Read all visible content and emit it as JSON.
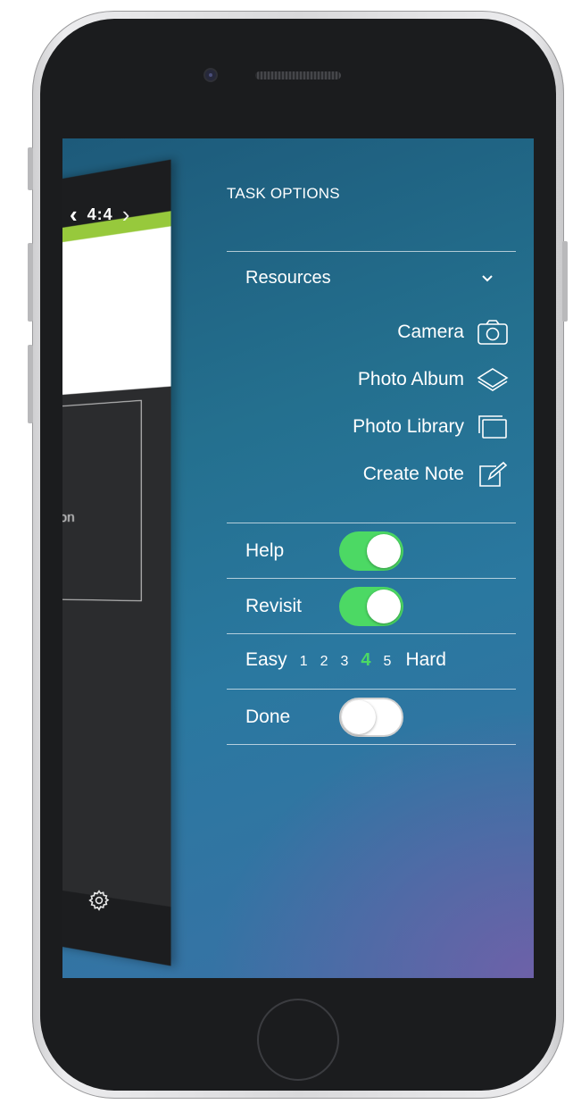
{
  "app_background": {
    "page_indicator": "4:4",
    "prev_icon": "chevron-left-icon",
    "next_icon": "chevron-right-icon",
    "truncated_text": "cher on",
    "settings_icon": "gear-icon",
    "accent_green": "#97c93c"
  },
  "task_options": {
    "title": "TASK OPTIONS",
    "resources": {
      "label": "Resources",
      "toggle_icon": "chevron-down-icon",
      "items": [
        {
          "label": "Camera",
          "icon": "camera-icon"
        },
        {
          "label": "Photo Album",
          "icon": "layers-icon"
        },
        {
          "label": "Photo Library",
          "icon": "library-icon"
        },
        {
          "label": "Create Note",
          "icon": "note-edit-icon"
        }
      ]
    },
    "help": {
      "label": "Help",
      "on": true
    },
    "revisit": {
      "label": "Revisit",
      "on": true
    },
    "difficulty": {
      "easy_label": "Easy",
      "hard_label": "Hard",
      "levels": [
        "1",
        "2",
        "3",
        "4",
        "5"
      ],
      "selected": "4"
    },
    "done": {
      "label": "Done",
      "on": false
    }
  },
  "colors": {
    "toggle_on": "#4cd964",
    "selected_level": "#4cd964",
    "panel_gradient_start": "#1d5a7a",
    "panel_gradient_end": "#7060a8"
  }
}
